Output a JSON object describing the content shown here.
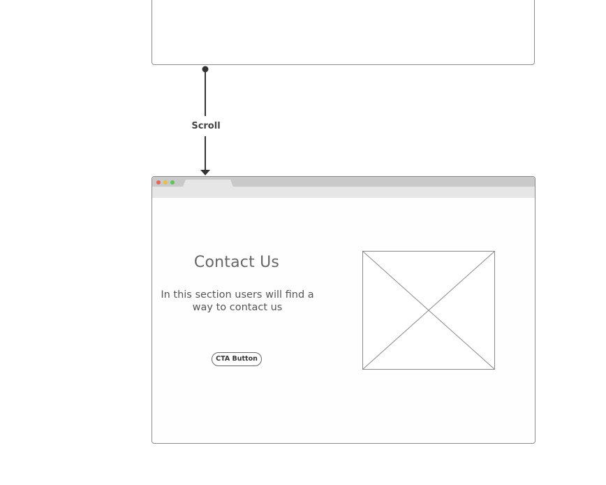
{
  "connector": {
    "label": "Scroll"
  },
  "browser": {
    "window_dots": [
      "#e0665e",
      "#e6c04a",
      "#5fc35b"
    ]
  },
  "contact_section": {
    "title": "Contact Us",
    "description": "In this section users will find a way to contact us",
    "cta_label": "CTA Button"
  },
  "icons": {
    "image_placeholder": "image-placeholder-icon",
    "arrow": "arrow-down-icon"
  }
}
